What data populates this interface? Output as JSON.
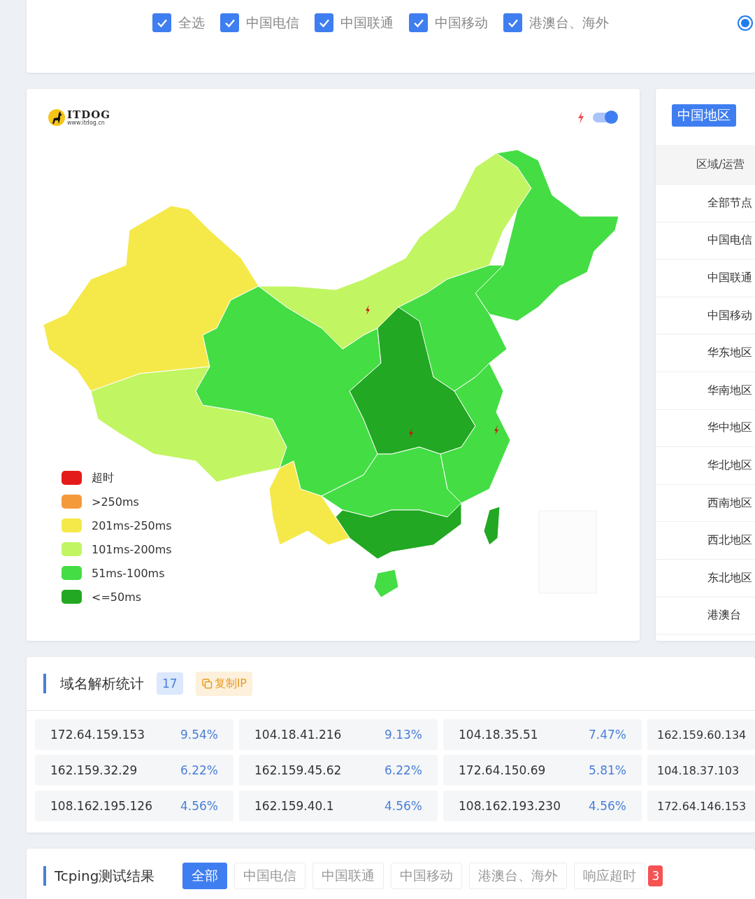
{
  "filters": [
    {
      "label": "全选",
      "checked": true
    },
    {
      "label": "中国电信",
      "checked": true
    },
    {
      "label": "中国联通",
      "checked": true
    },
    {
      "label": "中国移动",
      "checked": true
    },
    {
      "label": "港澳台、海外",
      "checked": true
    }
  ],
  "radio": {
    "selected": true
  },
  "map_panel": {
    "logo": {
      "name": "ITDOG",
      "url": "www.itdog.cn"
    },
    "toggle": {
      "on": true
    },
    "legend": [
      {
        "label": "超时",
        "color": "#e41b1b"
      },
      {
        "label": ">250ms",
        "color": "#f59a3a"
      },
      {
        "label": "201ms-250ms",
        "color": "#f5e94a"
      },
      {
        "label": "101ms-200ms",
        "color": "#c2f562"
      },
      {
        "label": "51ms-100ms",
        "color": "#44dd44"
      },
      {
        "label": "<=50ms",
        "color": "#22a822"
      }
    ]
  },
  "region_panel": {
    "tabs": [
      {
        "label": "中国地区",
        "selected": true
      }
    ],
    "header": "区域/运营",
    "rows": [
      "全部节点",
      "中国电信",
      "中国联通",
      "中国移动",
      "华东地区",
      "华南地区",
      "华中地区",
      "华北地区",
      "西南地区",
      "西北地区",
      "东北地区",
      "港澳台"
    ]
  },
  "dns_stats": {
    "title": "域名解析统计",
    "count": "17",
    "copy_button": "复制IP",
    "ips": [
      {
        "ip": "172.64.159.153",
        "share": "9.54%"
      },
      {
        "ip": "104.18.41.216",
        "share": "9.13%"
      },
      {
        "ip": "104.18.35.51",
        "share": "7.47%"
      },
      {
        "ip": "162.159.60.134"
      },
      {
        "ip": "162.159.32.29",
        "share": "6.22%"
      },
      {
        "ip": "162.159.45.62",
        "share": "6.22%"
      },
      {
        "ip": "172.64.150.69",
        "share": "5.81%"
      },
      {
        "ip": "104.18.37.103"
      },
      {
        "ip": "108.162.195.126",
        "share": "4.56%"
      },
      {
        "ip": "162.159.40.1",
        "share": "4.56%"
      },
      {
        "ip": "108.162.193.230",
        "share": "4.56%"
      },
      {
        "ip": "172.64.146.153"
      }
    ]
  },
  "tcping": {
    "title": "Tcping测试结果",
    "tabs": [
      {
        "label": "全部",
        "selected": true
      },
      {
        "label": "中国电信",
        "selected": false
      },
      {
        "label": "中国联通",
        "selected": false
      },
      {
        "label": "中国移动",
        "selected": false
      },
      {
        "label": "港澳台、海外",
        "selected": false
      },
      {
        "label": "响应超时",
        "selected": false,
        "badge": "3"
      }
    ]
  }
}
